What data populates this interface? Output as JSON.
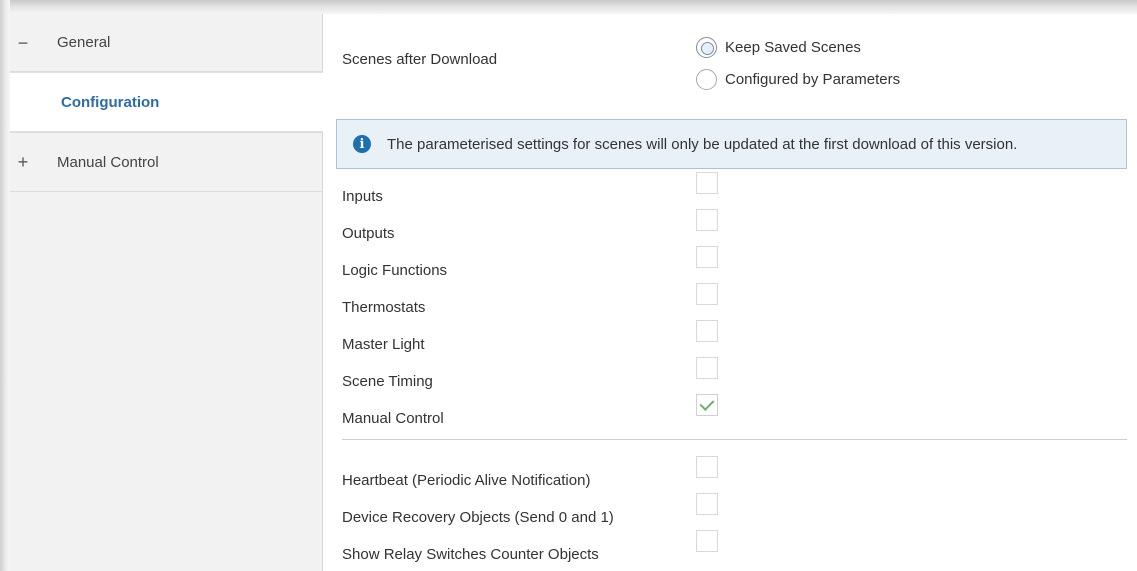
{
  "sidebar": {
    "items": [
      {
        "symbol": "−",
        "label": "General"
      },
      {
        "symbol": "",
        "label": "Configuration"
      },
      {
        "symbol": "+",
        "label": "Manual Control"
      }
    ]
  },
  "scenes": {
    "label": "Scenes after Download",
    "options": [
      {
        "label": "Keep Saved Scenes",
        "selected": true
      },
      {
        "label": "Configured by Parameters",
        "selected": false
      }
    ]
  },
  "info": {
    "icon": "info-icon",
    "text": "The parameterised settings for scenes will only be updated at the first download of this version."
  },
  "modules": [
    {
      "label": "Inputs",
      "checked": false
    },
    {
      "label": "Outputs",
      "checked": false
    },
    {
      "label": "Logic Functions",
      "checked": false
    },
    {
      "label": "Thermostats",
      "checked": false
    },
    {
      "label": "Master Light",
      "checked": false
    },
    {
      "label": "Scene Timing",
      "checked": false
    },
    {
      "label": "Manual Control",
      "checked": true
    }
  ],
  "extras": [
    {
      "label": "Heartbeat (Periodic Alive Notification)",
      "checked": false
    },
    {
      "label": "Device Recovery Objects (Send 0 and 1)",
      "checked": false
    },
    {
      "label": "Show Relay Switches Counter Objects",
      "checked": false
    }
  ]
}
